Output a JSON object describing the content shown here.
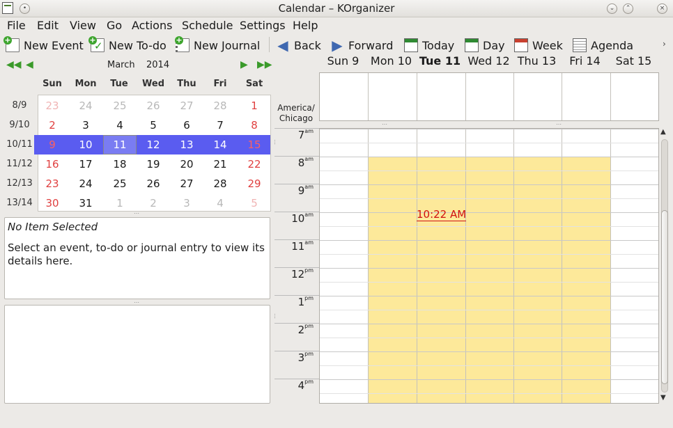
{
  "window": {
    "title": "Calendar – KOrganizer"
  },
  "menu": [
    "File",
    "Edit",
    "View",
    "Go",
    "Actions",
    "Schedule",
    "Settings",
    "Help"
  ],
  "toolbar": {
    "new_event": "New Event",
    "new_todo": "New To-do",
    "new_journal": "New Journal",
    "back": "Back",
    "forward": "Forward",
    "today": "Today",
    "day": "Day",
    "week": "Week",
    "agenda": "Agenda"
  },
  "navigator": {
    "month": "March",
    "year": "2014",
    "days_of_week": [
      "Sun",
      "Mon",
      "Tue",
      "Wed",
      "Thu",
      "Fri",
      "Sat"
    ],
    "weeks": [
      {
        "week": "8/9",
        "days": [
          "23",
          "24",
          "25",
          "26",
          "27",
          "28",
          "1"
        ]
      },
      {
        "week": "9/10",
        "days": [
          "2",
          "3",
          "4",
          "5",
          "6",
          "7",
          "8"
        ]
      },
      {
        "week": "10/11",
        "days": [
          "9",
          "10",
          "11",
          "12",
          "13",
          "14",
          "15"
        ]
      },
      {
        "week": "11/12",
        "days": [
          "16",
          "17",
          "18",
          "19",
          "20",
          "21",
          "22"
        ]
      },
      {
        "week": "12/13",
        "days": [
          "23",
          "24",
          "25",
          "26",
          "27",
          "28",
          "29"
        ]
      },
      {
        "week": "13/14",
        "days": [
          "30",
          "31",
          "1",
          "2",
          "3",
          "4",
          "5"
        ]
      }
    ]
  },
  "details": {
    "title": "No Item Selected",
    "text": "Select an event, to-do or journal entry to view its details here."
  },
  "agenda": {
    "timezone_line1": "America/",
    "timezone_line2": "Chicago",
    "columns": [
      "Sun 9",
      "Mon 10",
      "Tue 11",
      "Wed 12",
      "Thu 13",
      "Fri 14",
      "Sat 15"
    ],
    "hours": [
      {
        "h": "7",
        "ap": "am"
      },
      {
        "h": "8",
        "ap": "am"
      },
      {
        "h": "9",
        "ap": "am"
      },
      {
        "h": "10",
        "ap": "am"
      },
      {
        "h": "11",
        "ap": "am"
      },
      {
        "h": "12",
        "ap": "pm"
      },
      {
        "h": "1",
        "ap": "pm"
      },
      {
        "h": "2",
        "ap": "pm"
      },
      {
        "h": "3",
        "ap": "pm"
      },
      {
        "h": "4",
        "ap": "pm"
      }
    ],
    "current_time": "10:22 AM"
  },
  "colors": {
    "selection": "#5a5cf0",
    "weekend": "#e04040",
    "work_hours": "#fde99a",
    "current_time": "#d01010"
  }
}
